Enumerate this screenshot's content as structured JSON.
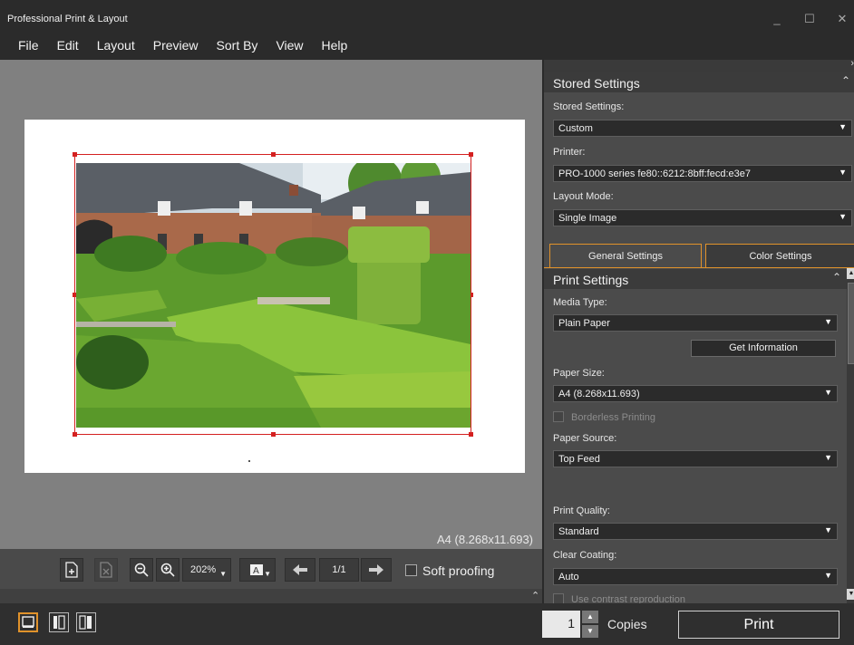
{
  "window": {
    "title": "Professional Print & Layout",
    "controls": [
      "_",
      "☐",
      "✕"
    ]
  },
  "menu": [
    "File",
    "Edit",
    "Layout",
    "Preview",
    "Sort By",
    "View",
    "Help"
  ],
  "canvas": {
    "paper_size_label": "A4 (8.268x11.693)"
  },
  "toolbar": {
    "zoom": "202%",
    "page": "1/1",
    "soft_proofing_label": "Soft proofing"
  },
  "panel": {
    "stored_section": "Stored Settings",
    "stored_label": "Stored Settings:",
    "stored_value": "Custom",
    "printer_label": "Printer:",
    "printer_value": "PRO-1000 series fe80::6212:8bff:fecd:e3e7",
    "layout_mode_label": "Layout Mode:",
    "layout_mode_value": "Single Image",
    "tabs": [
      "General Settings",
      "Color Settings"
    ],
    "print_section": "Print Settings",
    "media_type_label": "Media Type:",
    "media_type_value": "Plain Paper",
    "get_info_label": "Get Information",
    "paper_size_label": "Paper Size:",
    "paper_size_value": "A4 (8.268x11.693)",
    "borderless_label": "Borderless Printing",
    "paper_source_label": "Paper Source:",
    "paper_source_value": "Top Feed",
    "quality_label": "Print Quality:",
    "quality_value": "Standard",
    "coating_label": "Clear Coating:",
    "coating_value": "Auto",
    "contrast_label": "Use contrast reproduction"
  },
  "bottom": {
    "copies_value": "1",
    "copies_label": "Copies",
    "print_label": "Print"
  },
  "colors": {
    "accent": "#e0922b",
    "selection": "#d42020"
  }
}
